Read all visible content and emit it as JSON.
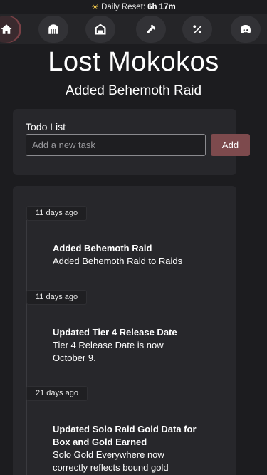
{
  "reset": {
    "label": "Daily Reset:",
    "time": "6h 17m"
  },
  "nav": {
    "items": [
      {
        "name": "home",
        "icon": "home-icon"
      },
      {
        "name": "raids",
        "icon": "gate-icon"
      },
      {
        "name": "stronghold",
        "icon": "stronghold-icon"
      },
      {
        "name": "crafting",
        "icon": "hammer-icon"
      },
      {
        "name": "percent",
        "icon": "percent-icon"
      },
      {
        "name": "discord",
        "icon": "discord-icon"
      }
    ]
  },
  "page": {
    "title": "Lost Mokokos",
    "subtitle": "Added Behemoth Raid"
  },
  "todo": {
    "label": "Todo List",
    "placeholder": "Add a new task",
    "value": "",
    "add_label": "Add"
  },
  "updates": [
    {
      "time": "11 days ago",
      "title": "Added Behemoth Raid",
      "body": "Added Behemoth Raid to Raids"
    },
    {
      "time": "11 days ago",
      "title": "Updated Tier 4 Release Date",
      "body": "Tier 4 Release Date is now October 9."
    },
    {
      "time": "21 days ago",
      "title": "Updated Solo Raid Gold Data for Box and Gold Earned",
      "body": "Solo Gold Everywhere now correctly reflects bound gold"
    }
  ],
  "colors": {
    "background": "#1c1c1f",
    "card": "#27272b",
    "accent": "#7d4a4d"
  }
}
